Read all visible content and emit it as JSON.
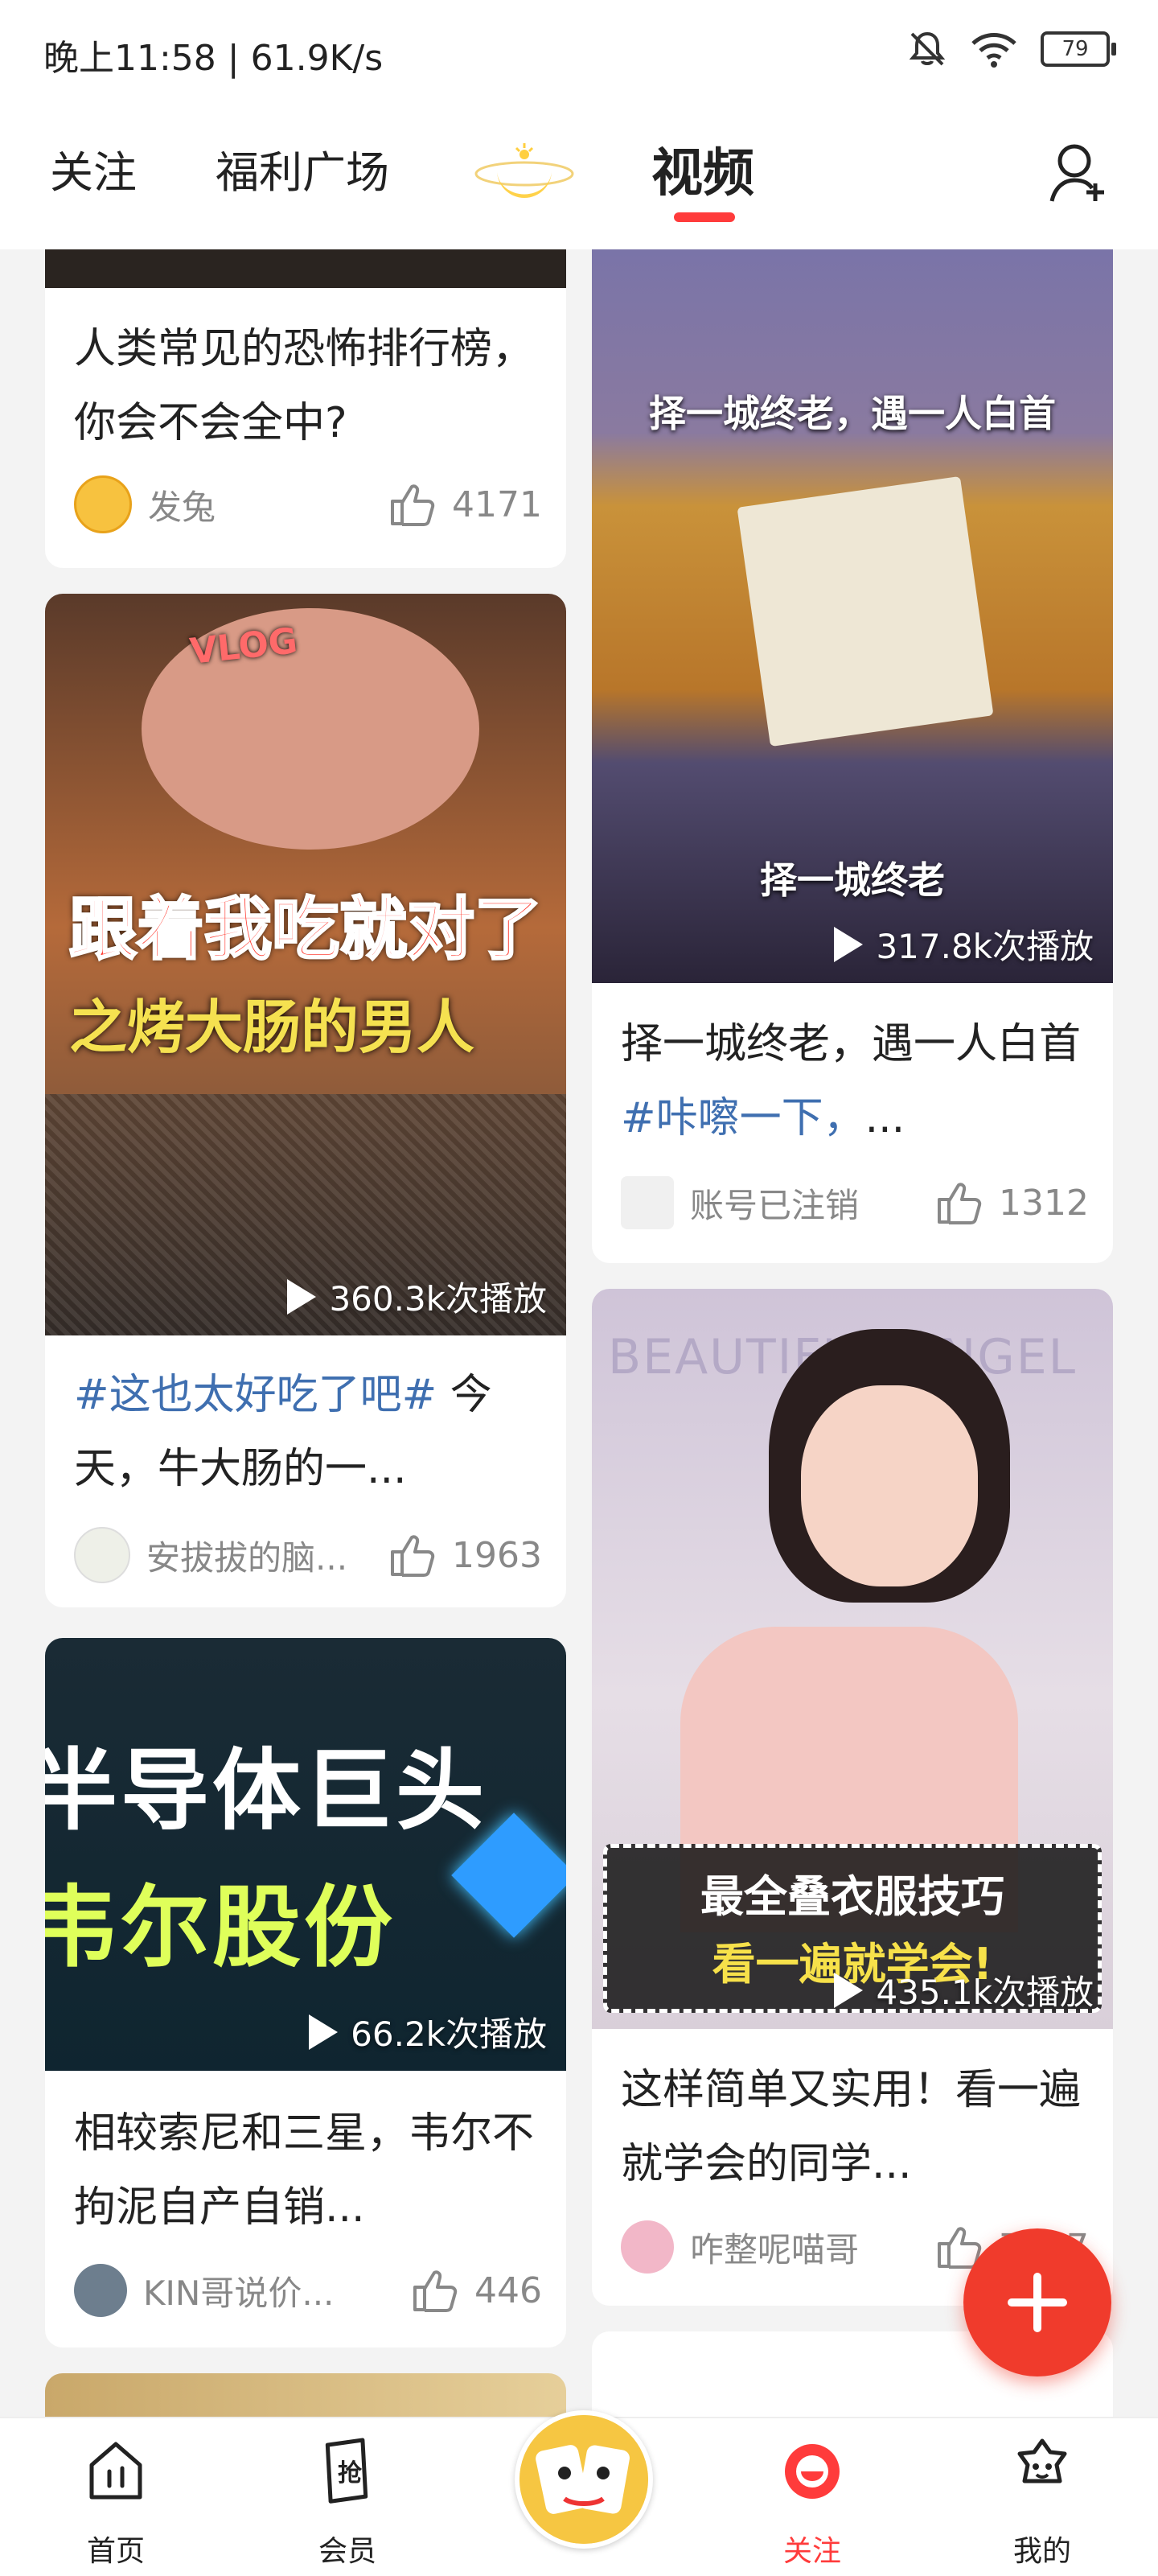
{
  "status_bar": {
    "time_speed": "晚上11:58 | 61.9K/s",
    "battery": "79",
    "icons": [
      "bell-off-icon",
      "wifi-icon",
      "battery-icon"
    ]
  },
  "top_nav": {
    "tabs": [
      {
        "label": "关注"
      },
      {
        "label": "福利广场"
      },
      {
        "label": "视频"
      }
    ],
    "active_tab": "视频",
    "accent": "#ff3b3b"
  },
  "feed": {
    "left": [
      {
        "title": "人类常见的恐怖排行榜，你会不会全中?",
        "hashtag": "",
        "author": "发兔",
        "likes": "4171",
        "plays": ""
      },
      {
        "hashtag": "#这也太好吃了吧#",
        "title": " 今天，牛大肠的一...",
        "author": "安拔拔的脑...",
        "likes": "1963",
        "plays": "360.3k次播放",
        "overlay": {
          "vlog": "VLOG",
          "line1": "跟着我吃就对了",
          "line2": "之烤大肠的男人"
        }
      },
      {
        "title": "相较索尼和三星，韦尔不拘泥自产自销...",
        "hashtag": "",
        "author": "KIN哥说价...",
        "likes": "446",
        "plays": "66.2k次播放",
        "overlay": {
          "line1": "半导体巨头",
          "line2": "韦尔股份"
        }
      }
    ],
    "right": [
      {
        "title": "择一城终老，遇一人白首 ",
        "hashtag": "#咔嚓一下，",
        "suffix": "...",
        "author": "账号已注销",
        "likes": "1312",
        "plays": "317.8k次播放",
        "overlay": {
          "top": "择一城终老，遇一人白首",
          "mid": "择一城终老"
        }
      },
      {
        "title": "这样简单又实用！看一遍就学会的同学...",
        "hashtag": "",
        "author": "咋整呢喵哥",
        "likes": "7777",
        "plays": "435.1k次播放",
        "overlay": {
          "line1": "最全叠衣服技巧",
          "line2": "看一遍就学会!",
          "bg_text": "BEAUTIFUL ANGEL"
        }
      }
    ]
  },
  "bottom_nav": {
    "items": [
      {
        "label": "首页",
        "icon": "home-icon"
      },
      {
        "label": "会员",
        "icon": "grab-icon"
      },
      {
        "label": "",
        "icon": "center-avatar"
      },
      {
        "label": "关注",
        "icon": "follow-icon"
      },
      {
        "label": "我的",
        "icon": "profile-icon"
      }
    ],
    "active_color": "#ff3b3b"
  }
}
